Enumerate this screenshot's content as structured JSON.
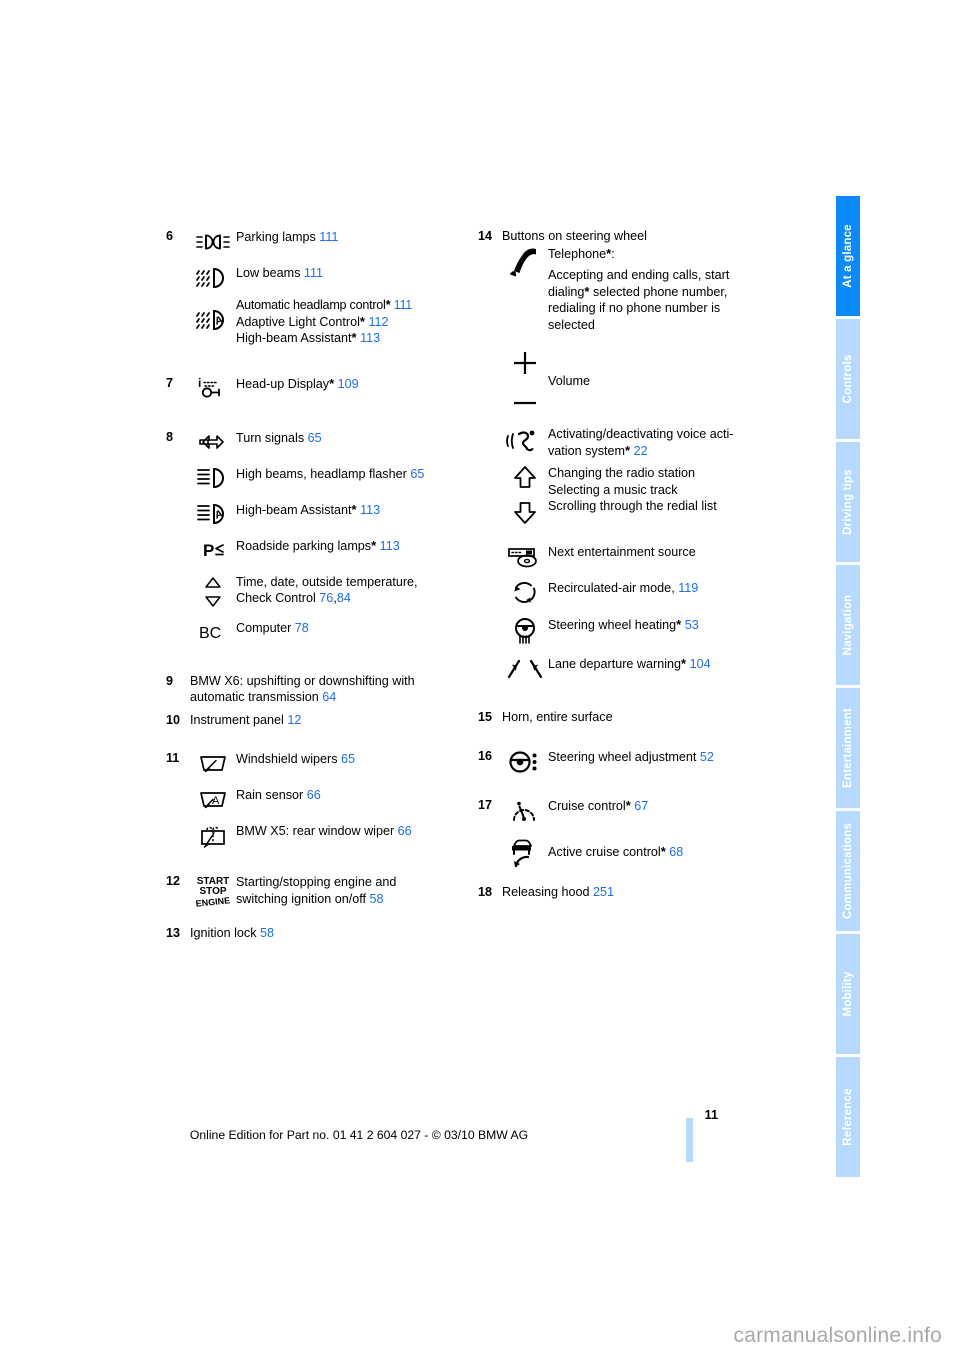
{
  "page": {
    "number": "11",
    "footer_text": "Online Edition for Part no. 01 41 2 604 027 - © 03/10 BMW AG",
    "watermark": "carmanualsonline.info",
    "link_color": "#1a6ef5",
    "tab_active_color": "#0a8aff",
    "tab_inactive_color": "#b6daff"
  },
  "tabs": [
    {
      "label": "At a glance",
      "active": true
    },
    {
      "label": "Controls",
      "active": false
    },
    {
      "label": "Driving tips",
      "active": false
    },
    {
      "label": "Navigation",
      "active": false
    },
    {
      "label": "Entertainment",
      "active": false
    },
    {
      "label": "Communications",
      "active": false
    },
    {
      "label": "Mobility",
      "active": false
    },
    {
      "label": "Reference",
      "active": false
    }
  ],
  "left_column": {
    "item6": {
      "number": "6",
      "rows": [
        {
          "icon": "parking-lamps-icon",
          "label": "Parking lamps",
          "ref": "111"
        },
        {
          "icon": "low-beams-icon",
          "label": "Low beams",
          "ref": "111"
        }
      ],
      "group_icon": "automatic-headlamp-control-icon",
      "group_lines": [
        {
          "label": "Automatic headlamp control",
          "star": "*",
          "ref": "111"
        },
        {
          "label": "Adaptive Light Control",
          "star": "*",
          "ref": "112"
        },
        {
          "label": "High-beam Assistant",
          "star": "*",
          "ref": "113"
        }
      ]
    },
    "item7": {
      "number": "7",
      "icon": "head-up-display-icon",
      "label": "Head-up Display",
      "star": "*",
      "ref": "109"
    },
    "item8": {
      "number": "8",
      "rows": [
        {
          "icon": "turn-signals-icon",
          "label": "Turn signals",
          "ref": "65"
        },
        {
          "icon": "high-beams-flasher-icon",
          "label": "High beams, headlamp flasher",
          "ref": "65"
        },
        {
          "icon": "high-beam-assistant-icon",
          "label": "High-beam Assistant",
          "star": "*",
          "ref": "113"
        },
        {
          "icon": "roadside-parking-lamps-icon",
          "label": "Roadside parking lamps",
          "star": "*",
          "ref": "113"
        }
      ],
      "check_control": {
        "icon": "up-down-triangles-icon",
        "line1": "Time, date, outside temperature,",
        "line2_label": "Check Control",
        "ref1": "76",
        "ref_sep": ",",
        "ref2": "84"
      },
      "computer": {
        "icon": "bc-computer-icon",
        "label": "Computer",
        "ref": "78"
      }
    },
    "item9": {
      "number": "9",
      "line1": "BMW X6: upshifting or downshifting with",
      "line2": "automatic transmission",
      "ref": "64"
    },
    "item10": {
      "number": "10",
      "label": "Instrument panel",
      "ref": "12"
    },
    "item11": {
      "number": "11",
      "rows": [
        {
          "icon": "windshield-wipers-icon",
          "label": "Windshield wipers",
          "ref": "65"
        },
        {
          "icon": "rain-sensor-icon",
          "label": "Rain sensor",
          "ref": "66"
        },
        {
          "icon": "rear-window-wiper-icon",
          "label": "BMW X5: rear window wiper",
          "ref": "66"
        }
      ]
    },
    "item12": {
      "number": "12",
      "icon": "start-stop-engine-icon",
      "icon_text": {
        "line1": "START",
        "line2": "STOP",
        "line3": "ENGINE"
      },
      "line1": "Starting/stopping engine and",
      "line2": "switching ignition on/off",
      "ref": "58"
    },
    "item13": {
      "number": "13",
      "label": "Ignition lock",
      "ref": "58"
    }
  },
  "right_column": {
    "item14": {
      "number": "14",
      "title": "Buttons on steering wheel",
      "telephone": {
        "icon": "telephone-handset-icon",
        "label": "Telephone",
        "star": "*",
        "colon": ":",
        "lines": [
          "Accepting and ending calls, start",
          "dialing* selected phone number,",
          "redialing if no phone number is",
          "selected"
        ],
        "line2_pre": "dialing",
        "line2_star": "*",
        "line2_post": " selected phone number,"
      },
      "volume": {
        "icon_plus": "plus-icon",
        "icon_minus": "minus-icon",
        "label": "Volume"
      },
      "voice": {
        "icon": "voice-activation-icon",
        "line1": "Activating/deactivating voice acti-",
        "line2": "vation system",
        "star": "*",
        "ref": "22"
      },
      "arrows": {
        "icon_up": "arrow-up-icon",
        "icon_down": "arrow-down-icon",
        "lines": [
          "Changing the radio station",
          "Selecting a music track",
          "Scrolling through the redial list"
        ]
      },
      "rows": [
        {
          "icon": "entertainment-source-icon",
          "label": "Next entertainment source",
          "ref": ""
        },
        {
          "icon": "recirculated-air-icon",
          "label": "Recirculated-air mode,",
          "ref": "119"
        },
        {
          "icon": "steering-wheel-heating-icon",
          "label": "Steering wheel heating",
          "star": "*",
          "ref": "53"
        },
        {
          "icon": "lane-departure-warning-icon",
          "label": "Lane departure warning",
          "star": "*",
          "ref": "104"
        }
      ]
    },
    "item15": {
      "number": "15",
      "label": "Horn, entire surface"
    },
    "item16": {
      "number": "16",
      "icon": "steering-wheel-adjustment-icon",
      "label": "Steering wheel adjustment",
      "ref": "52"
    },
    "item17": {
      "number": "17",
      "rows": [
        {
          "icon": "cruise-control-icon",
          "label": "Cruise control",
          "star": "*",
          "ref": "67"
        },
        {
          "icon": "active-cruise-control-icon",
          "label": "Active cruise control",
          "star": "*",
          "ref": "68"
        }
      ]
    },
    "item18": {
      "number": "18",
      "label": "Releasing hood",
      "ref": "251"
    }
  }
}
